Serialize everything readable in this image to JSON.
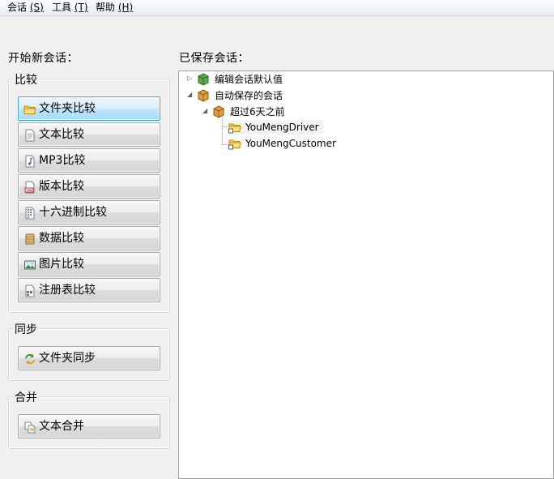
{
  "menu": [
    {
      "label": "会话",
      "key": "(S)"
    },
    {
      "label": "工具",
      "key": "(T)"
    },
    {
      "label": "帮助",
      "key": "(H)"
    }
  ],
  "left": {
    "title": "开始新会话：",
    "compare_group": {
      "label": "比较",
      "buttons": [
        {
          "label": "文件夹比较",
          "icon": "folder-icon"
        },
        {
          "label": "文本比较",
          "icon": "text-file-icon"
        },
        {
          "label": "MP3比较",
          "icon": "music-file-icon"
        },
        {
          "label": "版本比较",
          "icon": "version-icon"
        },
        {
          "label": "十六进制比较",
          "icon": "hex-icon"
        },
        {
          "label": "数据比较",
          "icon": "database-icon"
        },
        {
          "label": "图片比较",
          "icon": "picture-icon"
        },
        {
          "label": "注册表比较",
          "icon": "registry-icon"
        }
      ]
    },
    "sync_group": {
      "label": "同步",
      "buttons": [
        {
          "label": "文件夹同步",
          "icon": "sync-icon"
        }
      ]
    },
    "merge_group": {
      "label": "合并",
      "buttons": [
        {
          "label": "文本合并",
          "icon": "merge-icon"
        }
      ]
    }
  },
  "right": {
    "title": "已保存会话：",
    "tree": [
      {
        "label": "编辑会话默认值",
        "icon": "green-cube-icon",
        "expander": "collapsed"
      },
      {
        "label": "自动保存的会话",
        "icon": "orange-cube-icon",
        "expander": "expanded"
      },
      {
        "label": "超过6天之前",
        "icon": "orange-cube-icon",
        "expander": "expanded"
      },
      {
        "label": "YouMengDriver",
        "icon": "session-folder-icon"
      },
      {
        "label": "YouMengCustomer",
        "icon": "session-folder-icon"
      }
    ]
  },
  "colors": {
    "background": "#f0f0f0",
    "active_button_border": "#4c9fd9",
    "active_button_fill": "#bee6fd"
  }
}
